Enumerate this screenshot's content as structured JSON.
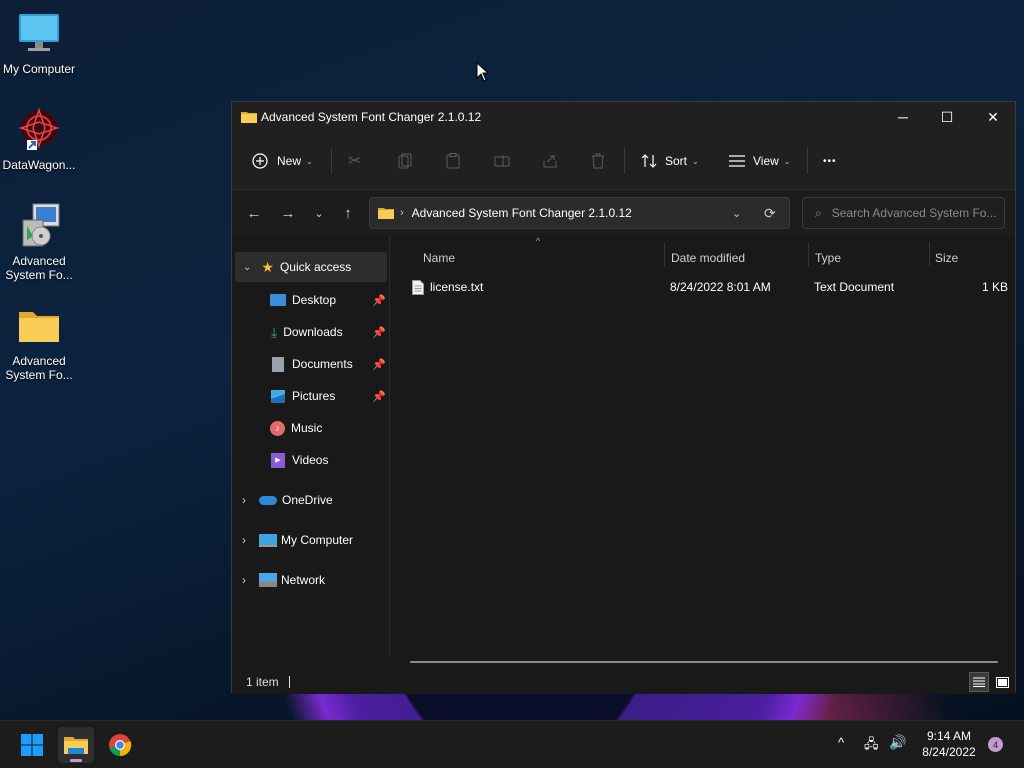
{
  "desktop": {
    "icons": [
      {
        "label": "My Computer"
      },
      {
        "label": "DataWagon..."
      },
      {
        "label": "Advanced\nSystem Fo..."
      },
      {
        "label": "Advanced\nSystem Fo..."
      }
    ]
  },
  "window": {
    "title": "Advanced System Font Changer 2.1.0.12",
    "controls": {
      "minimize": "─",
      "maximize": "☐",
      "close": "✕"
    }
  },
  "toolbar": {
    "new_label": "New",
    "sort_label": "Sort",
    "view_label": "View",
    "more_label": "•••"
  },
  "address": {
    "path": "Advanced System Font Changer 2.1.0.12",
    "search_placeholder": "Search Advanced System Fo..."
  },
  "sidebar": {
    "items": [
      {
        "label": "Quick access"
      },
      {
        "label": "Desktop"
      },
      {
        "label": "Downloads"
      },
      {
        "label": "Documents"
      },
      {
        "label": "Pictures"
      },
      {
        "label": "Music"
      },
      {
        "label": "Videos"
      },
      {
        "label": "OneDrive"
      },
      {
        "label": "My Computer"
      },
      {
        "label": "Network"
      }
    ]
  },
  "table": {
    "columns": [
      "Name",
      "Date modified",
      "Type",
      "Size"
    ],
    "rows": [
      {
        "name": "license.txt",
        "date": "8/24/2022 8:01 AM",
        "type": "Text Document",
        "size": "1 KB"
      }
    ]
  },
  "status": {
    "count": "1 item"
  },
  "taskbar": {
    "time": "9:14 AM",
    "date": "8/24/2022",
    "notification_count": "4"
  },
  "colors": {
    "accent": "#0078d4",
    "folder": "#f3c64c",
    "badge": "#c39bd3"
  }
}
